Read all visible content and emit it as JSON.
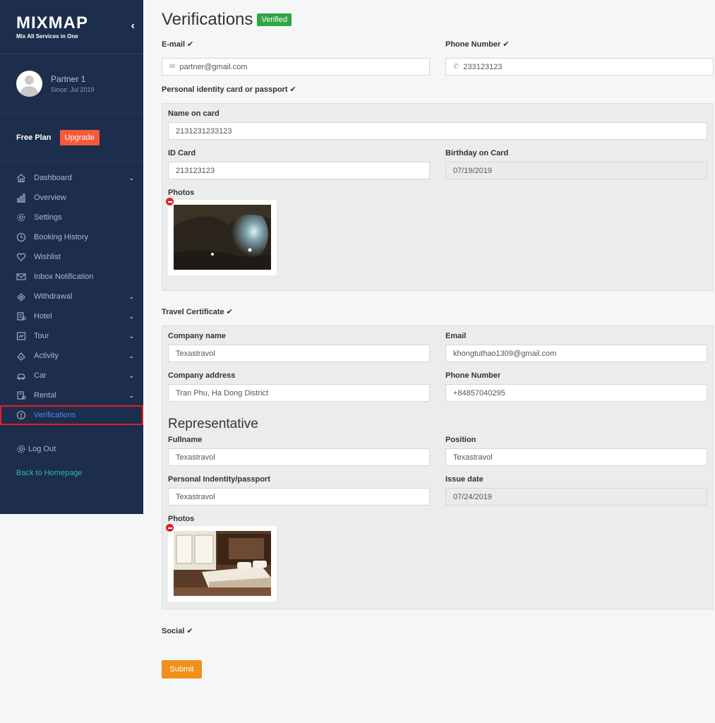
{
  "brand": {
    "name": "MIXMAP",
    "tagline": "Mix All Services in One"
  },
  "profile": {
    "name": "Partner 1",
    "since": "Since: Jul 2019"
  },
  "plan": {
    "label": "Free Plan",
    "upgrade": "Upgrade"
  },
  "menu": [
    {
      "label": "Dashboard",
      "icon": "home-icon",
      "chevron": true
    },
    {
      "label": "Overview",
      "icon": "chart-icon",
      "chevron": false
    },
    {
      "label": "Settings",
      "icon": "gear-icon",
      "chevron": false
    },
    {
      "label": "Booking History",
      "icon": "clock-icon",
      "chevron": false
    },
    {
      "label": "Wishlist",
      "icon": "heart-icon",
      "chevron": false
    },
    {
      "label": "Inbox Notification",
      "icon": "mail-icon",
      "chevron": false
    },
    {
      "label": "Withdrawal",
      "icon": "money-icon",
      "chevron": true
    },
    {
      "label": "Hotel",
      "icon": "hotel-icon",
      "chevron": true
    },
    {
      "label": "Tour",
      "icon": "map-icon",
      "chevron": true
    },
    {
      "label": "Activity",
      "icon": "activity-icon",
      "chevron": true
    },
    {
      "label": "Car",
      "icon": "car-icon",
      "chevron": true
    },
    {
      "label": "Rental",
      "icon": "rental-icon",
      "chevron": true
    },
    {
      "label": "Verifications",
      "icon": "info-icon",
      "chevron": false,
      "active": true
    }
  ],
  "logout": "Log Out",
  "back_home": "Back to Homepage",
  "page": {
    "title": "Verifications",
    "badge": "Verified"
  },
  "contact": {
    "email_label": "E-mail",
    "email_value": "partner@gmail.com",
    "phone_label": "Phone Number",
    "phone_value": "233123123"
  },
  "identity": {
    "section_label": "Personal identity card or passport",
    "name_label": "Name on card",
    "name_value": "2131231233123",
    "id_label": "ID Card",
    "id_value": "213123123",
    "birthday_label": "Birthday on Card",
    "birthday_value": "07/19/2019",
    "photos_label": "Photos"
  },
  "travel": {
    "section_label": "Travel Certificate",
    "company_label": "Company name",
    "company_value": "Texastravol",
    "email_label": "Email",
    "email_value": "khongtuthao1309@gmail.com",
    "address_label": "Company address",
    "address_value": "Tran Phu, Ha Dong District",
    "phone_label": "Phone Number",
    "phone_value": "+84857040295",
    "rep_title": "Representative",
    "fullname_label": "Fullname",
    "fullname_value": "Texastravol",
    "position_label": "Position",
    "position_value": "Texastravol",
    "passport_label": "Personal Indentity/passport",
    "passport_value": "Texastravol",
    "issue_label": "Issue date",
    "issue_value": "07/24/2019",
    "photos_label": "Photos"
  },
  "social_label": "Social",
  "submit_label": "Submit",
  "colors": {
    "sidebar": "#1d2d4c",
    "accent": "#4a8af0",
    "upgrade": "#f55a3a",
    "verified": "#2fa544",
    "submit": "#f0901a"
  }
}
